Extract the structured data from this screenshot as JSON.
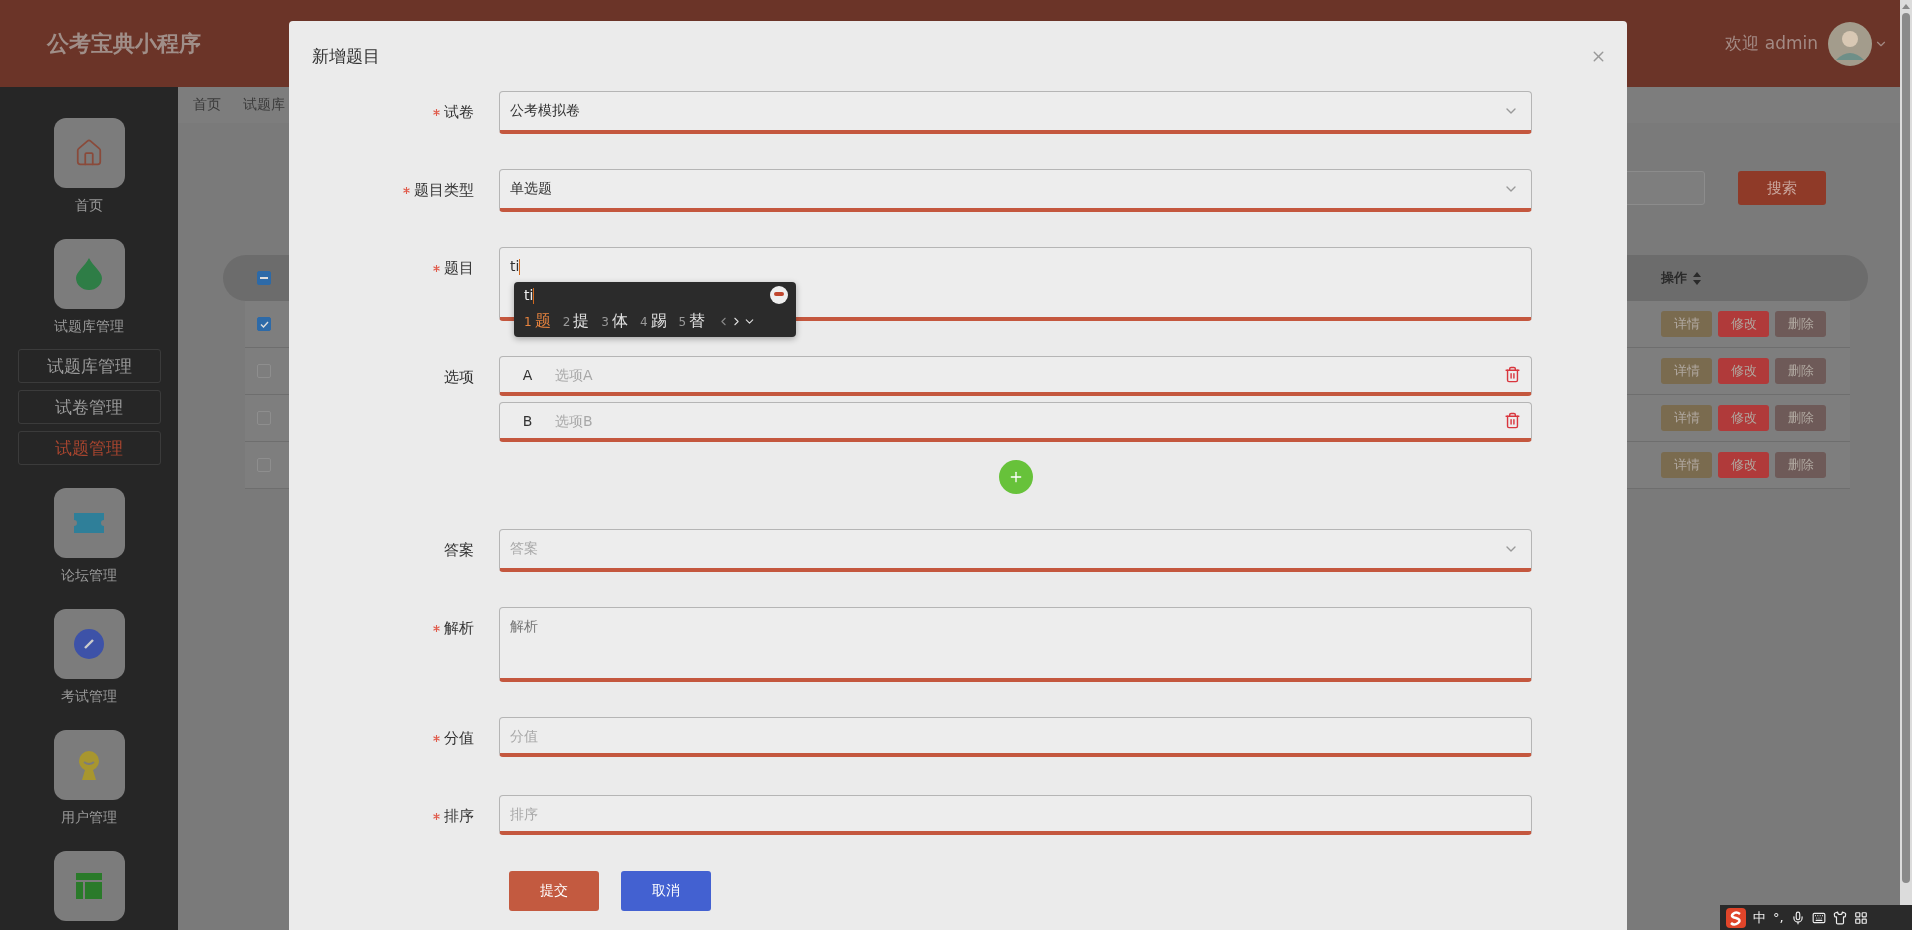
{
  "header": {
    "title": "公考宝典小程序",
    "welcome": "欢迎 admin"
  },
  "sidebar": {
    "items": [
      {
        "kind": "home",
        "label": "首页"
      },
      {
        "kind": "drop",
        "label": "试题库管理",
        "children": [
          {
            "label": "试题库管理",
            "selected": false
          },
          {
            "label": "试卷管理",
            "selected": false
          },
          {
            "label": "试题管理",
            "selected": true
          }
        ]
      },
      {
        "kind": "ticket",
        "label": "论坛管理"
      },
      {
        "kind": "pen",
        "label": "考试管理"
      },
      {
        "kind": "badge",
        "label": "用户管理"
      },
      {
        "kind": "layout"
      }
    ]
  },
  "breadcrumb": [
    "首页",
    "试题库"
  ],
  "search_button": "搜索",
  "table": {
    "select_all": {
      "indeterminate": true
    },
    "action_column": "操作",
    "rows": [
      {
        "checked": true,
        "actions": [
          "详情",
          "修改",
          "删除"
        ]
      },
      {
        "checked": false,
        "actions": [
          "详情",
          "修改",
          "删除"
        ]
      },
      {
        "checked": false,
        "actions": [
          "详情",
          "修改",
          "删除"
        ]
      },
      {
        "checked": false,
        "actions": [
          "详情",
          "修改",
          "删除"
        ]
      }
    ]
  },
  "dialog": {
    "title": "新增题目",
    "fields": [
      {
        "kind": "select",
        "label": "试卷",
        "required": true,
        "value": "公考模拟卷"
      },
      {
        "kind": "select",
        "label": "题目类型",
        "required": true,
        "value": "单选题"
      },
      {
        "kind": "textarea",
        "label": "题目",
        "required": true,
        "value": "ti"
      },
      {
        "kind": "options",
        "label": "选项",
        "required": false,
        "options": [
          {
            "letter": "A",
            "placeholder": "选项A"
          },
          {
            "letter": "B",
            "placeholder": "选项B"
          }
        ]
      },
      {
        "kind": "select",
        "label": "答案",
        "required": false,
        "placeholder": "答案"
      },
      {
        "kind": "textarea",
        "label": "解析",
        "required": true,
        "placeholder": "解析"
      },
      {
        "kind": "input",
        "label": "分值",
        "required": true,
        "placeholder": "分值"
      },
      {
        "kind": "input",
        "label": "排序",
        "required": true,
        "placeholder": "排序"
      }
    ],
    "buttons": [
      {
        "kind": "primary",
        "label": "提交"
      },
      {
        "kind": "secondary",
        "label": "取消"
      }
    ]
  },
  "ime": {
    "composition": "ti",
    "candidates": [
      {
        "index": "1",
        "text": "题",
        "selected": true
      },
      {
        "index": "2",
        "text": "提",
        "selected": false
      },
      {
        "index": "3",
        "text": "体",
        "selected": false
      },
      {
        "index": "4",
        "text": "踢",
        "selected": false
      },
      {
        "index": "5",
        "text": "替",
        "selected": false
      }
    ]
  },
  "ime_toolbar": {
    "mode": "中",
    "punctuation": "°,"
  }
}
